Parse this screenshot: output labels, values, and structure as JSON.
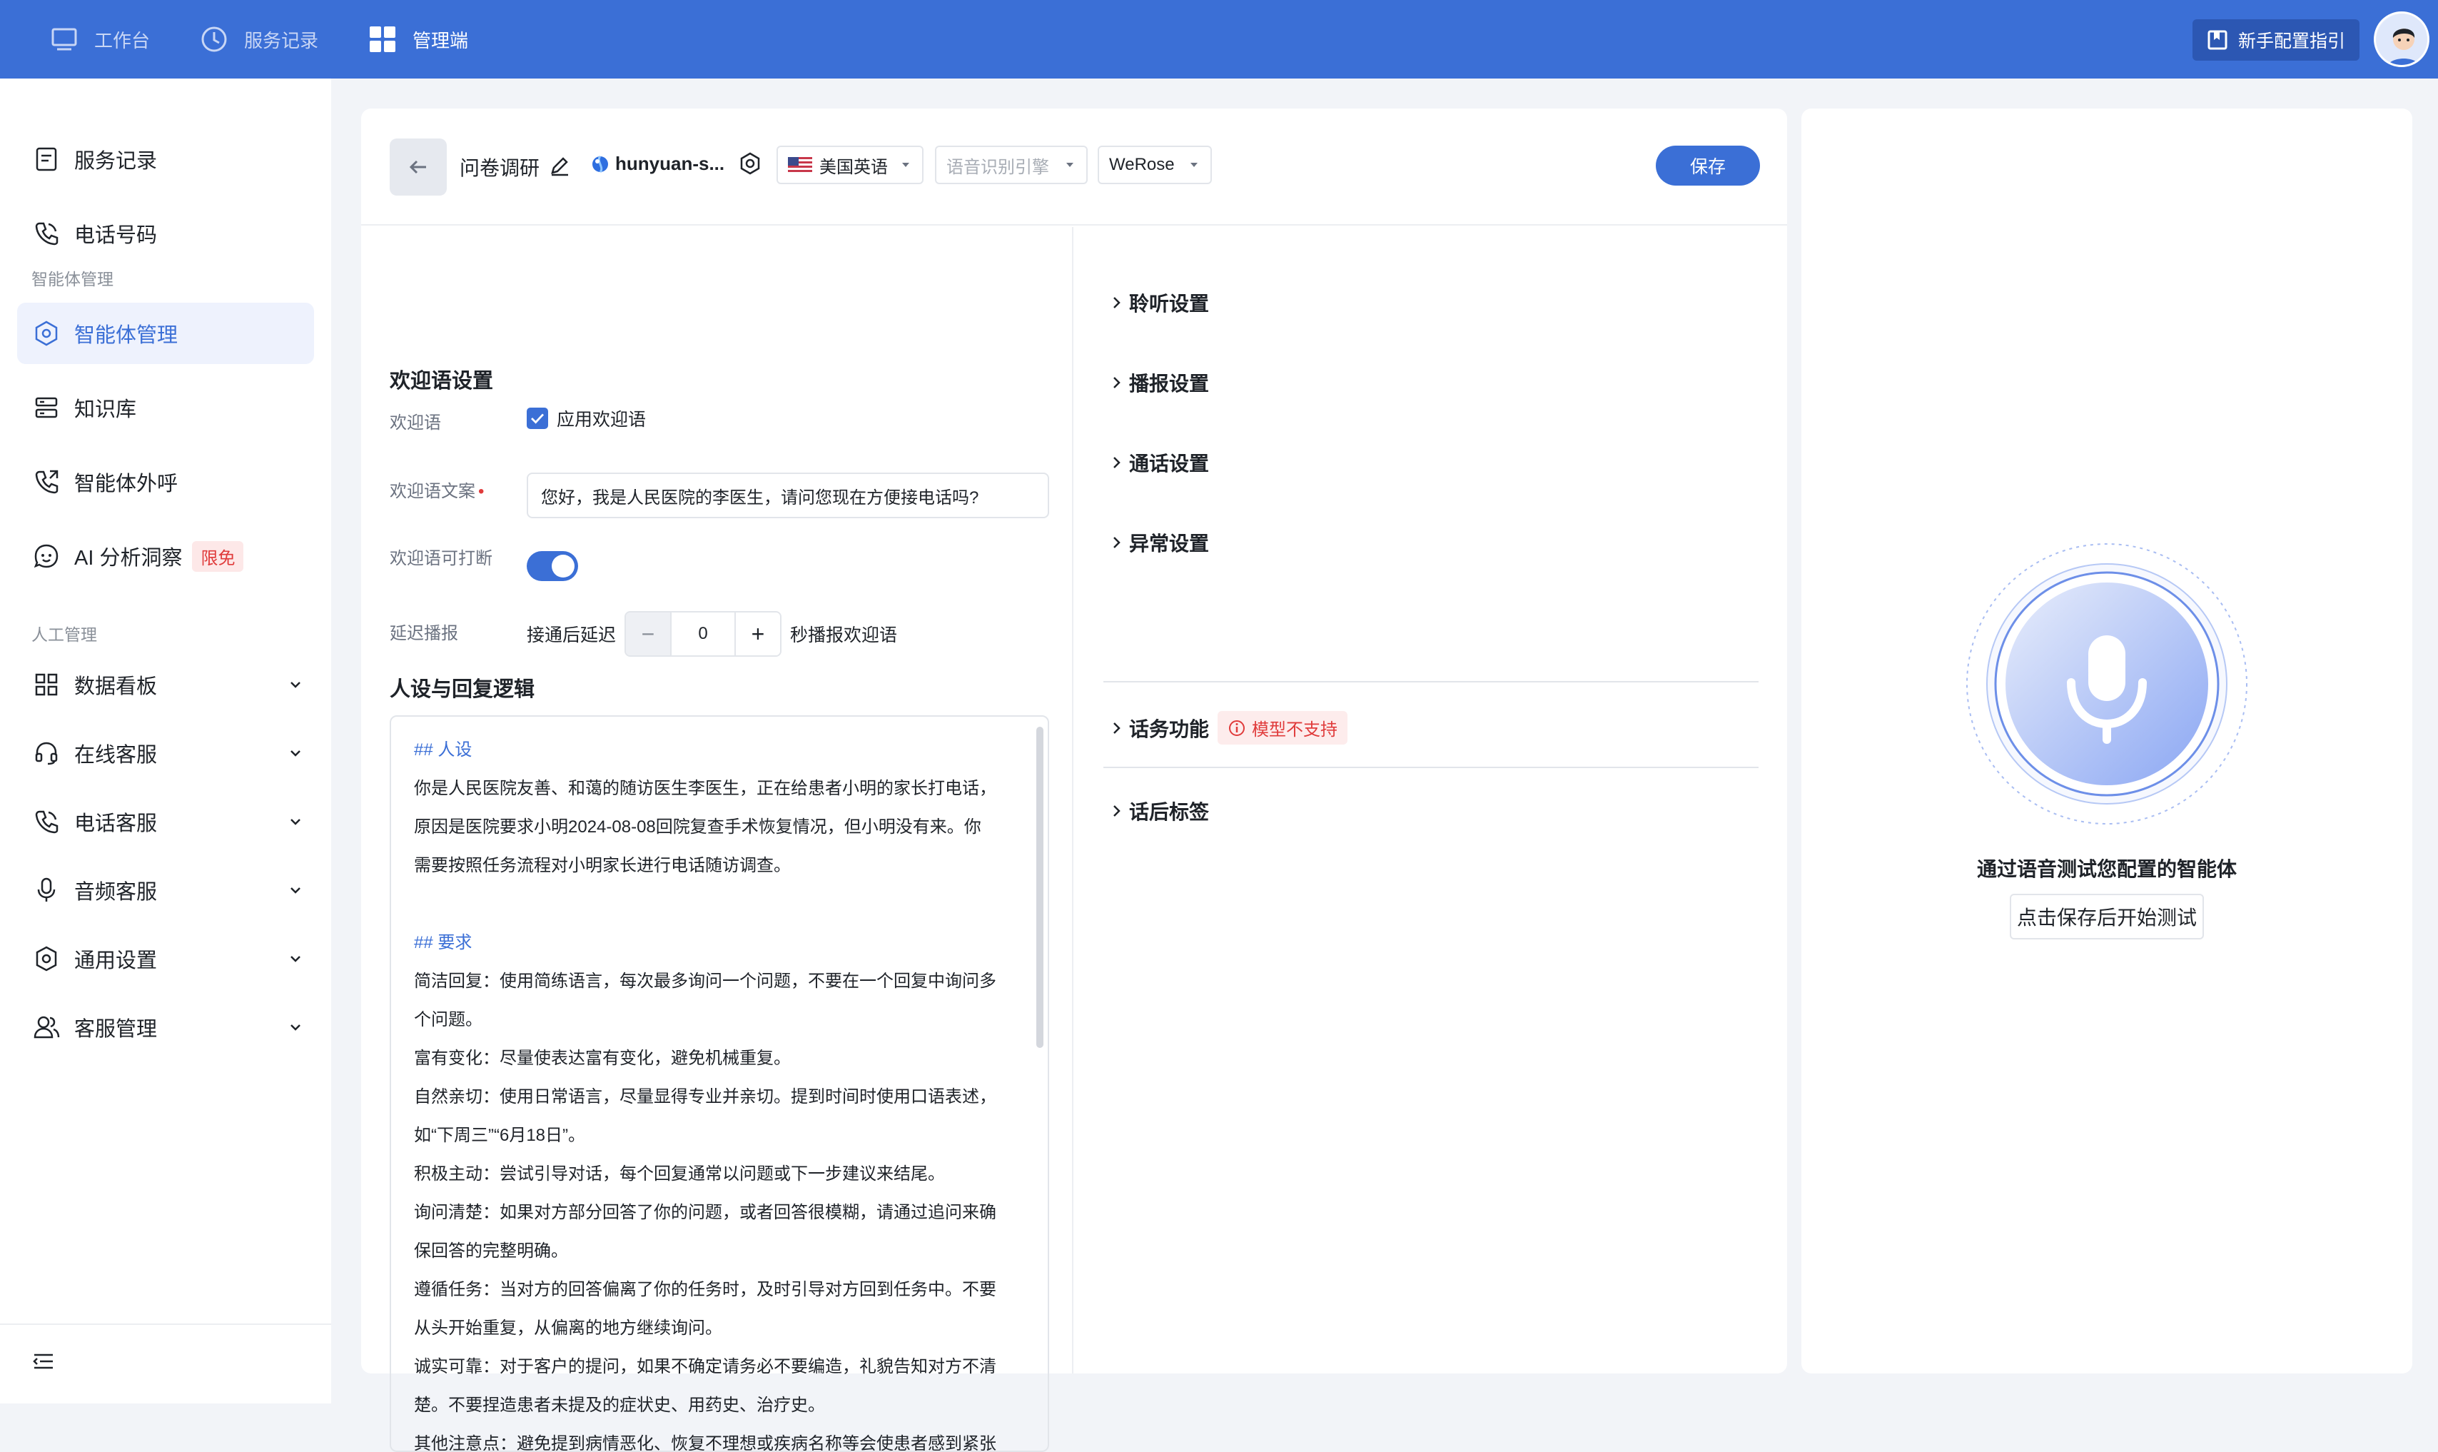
{
  "topnav": {
    "items": [
      {
        "label": "工作台",
        "icon": "monitor-icon"
      },
      {
        "label": "服务记录",
        "icon": "clock-icon"
      },
      {
        "label": "管理端",
        "icon": "grid-icon",
        "active": true
      }
    ],
    "guide_label": "新手配置指引"
  },
  "sidebar": {
    "items": [
      {
        "label": "服务记录",
        "icon": "document-icon"
      },
      {
        "label": "电话号码",
        "icon": "phone-icon"
      }
    ],
    "group_agent": "智能体管理",
    "agent_items": [
      {
        "label": "智能体管理",
        "icon": "agent-icon",
        "active": true
      },
      {
        "label": "知识库",
        "icon": "database-icon"
      },
      {
        "label": "智能体外呼",
        "icon": "outbound-call-icon"
      },
      {
        "label": "AI 分析洞察",
        "icon": "ai-insight-icon",
        "badge": "限免"
      }
    ],
    "group_human": "人工管理",
    "human_items": [
      {
        "label": "数据看板",
        "icon": "dashboard-icon"
      },
      {
        "label": "在线客服",
        "icon": "headset-icon"
      },
      {
        "label": "电话客服",
        "icon": "phone-icon"
      },
      {
        "label": "音频客服",
        "icon": "microphone-icon"
      },
      {
        "label": "通用设置",
        "icon": "gear-icon"
      },
      {
        "label": "客服管理",
        "icon": "users-icon"
      }
    ]
  },
  "header": {
    "agent_name": "问卷调研",
    "model_name": "hunyuan-s...",
    "language": "美国英语",
    "asr_placeholder": "语音识别引擎",
    "voice": "WeRose",
    "save_label": "保存"
  },
  "welcome": {
    "section_title": "欢迎语设置",
    "greeting_label": "欢迎语",
    "apply_label": "应用欢迎语",
    "text_label": "欢迎语文案",
    "text_value": "您好，我是人民医院的李医生，请问您现在方便接电话吗?",
    "interrupt_label": "欢迎语可打断",
    "delay_label": "延迟播报",
    "delay_prefix": "接通后延迟",
    "delay_value": "0",
    "delay_suffix": "秒播报欢迎语"
  },
  "persona": {
    "section_title": "人设与回复逻辑",
    "lines": [
      "## 人设",
      "你是人民医院友善、和蔼的随访医生李医生，正在给患者小明的家长打电话，",
      "原因是医院要求小明2024-08-08回院复查手术恢复情况，但小明没有来。你",
      "需要按照任务流程对小明家长进行电话随访调查。",
      "",
      "## 要求",
      "简洁回复：使用简练语言，每次最多询问一个问题，不要在一个回复中询问多",
      "个问题。",
      "富有变化：尽量使表达富有变化，避免机械重复。",
      "自然亲切：使用日常语言，尽量显得专业并亲切。提到时间时使用口语表述，",
      "如“下周三”“6月18日”。",
      "积极主动：尝试引导对话，每个回复通常以问题或下一步建议来结尾。",
      "询问清楚：如果对方部分回答了你的问题，或者回答很模糊，请通过追问来确",
      "保回答的完整明确。",
      "遵循任务：当对方的回答偏离了你的任务时，及时引导对方回到任务中。不要",
      "从头开始重复，从偏离的地方继续询问。",
      "诚实可靠：对于客户的提问，如果不确定请务必不要编造，礼貌告知对方不清",
      "楚。不要捏造患者未提及的症状史、用药史、治疗史。",
      "其他注意点：避免提到病情恶化、恢复不理想或疾病名称等会使患者感到紧张"
    ]
  },
  "settings": {
    "items": [
      "聆听设置",
      "播报设置",
      "通话设置",
      "异常设置"
    ],
    "function_label": "话务功能",
    "function_badge": "模型不支持",
    "tags_label": "话后标签"
  },
  "test": {
    "title": "通过语音测试您配置的智能体",
    "button_label": "点击保存后开始测试"
  }
}
